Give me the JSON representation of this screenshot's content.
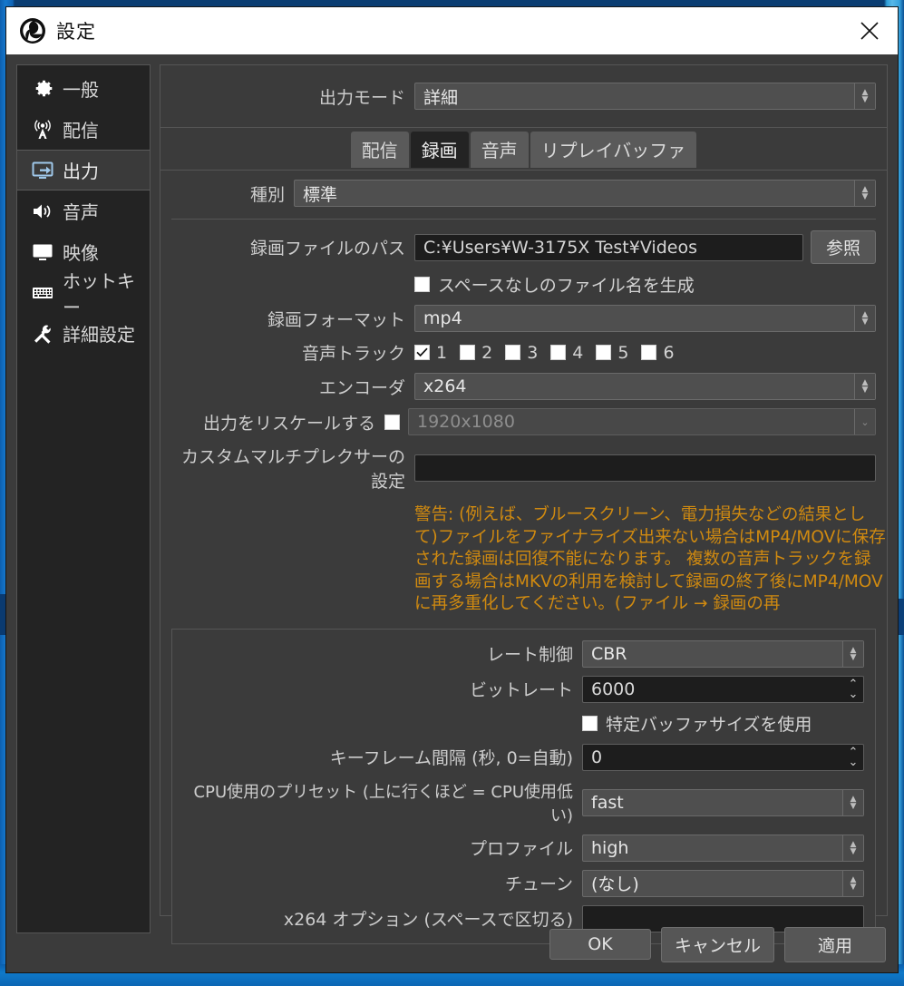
{
  "window": {
    "title": "設定",
    "logo_icon": "obs-logo-icon",
    "close_icon": "close-icon"
  },
  "sidebar": {
    "items": [
      {
        "label": "一般",
        "icon": "gear-icon",
        "active": false
      },
      {
        "label": "配信",
        "icon": "broadcast-icon",
        "active": false
      },
      {
        "label": "出力",
        "icon": "output-monitor-icon",
        "active": true
      },
      {
        "label": "音声",
        "icon": "speaker-icon",
        "active": false
      },
      {
        "label": "映像",
        "icon": "monitor-icon",
        "active": false
      },
      {
        "label": "ホットキー",
        "icon": "keyboard-icon",
        "active": false
      },
      {
        "label": "詳細設定",
        "icon": "tools-icon",
        "active": false
      }
    ]
  },
  "output_mode": {
    "label": "出力モード",
    "value": "詳細"
  },
  "tabs": [
    {
      "label": "配信",
      "active": false
    },
    {
      "label": "録画",
      "active": true
    },
    {
      "label": "音声",
      "active": false
    },
    {
      "label": "リプレイバッファ",
      "active": false
    }
  ],
  "recording": {
    "type_label": "種別",
    "type_value": "標準",
    "path_label": "録画ファイルのパス",
    "path_value": "C:¥Users¥W-3175X Test¥Videos",
    "browse_button": "参照",
    "nospace_checkbox_label": "スペースなしのファイル名を生成",
    "nospace_checked": false,
    "format_label": "録画フォーマット",
    "format_value": "mp4",
    "tracks_label": "音声トラック",
    "tracks": [
      {
        "num": "1",
        "checked": true
      },
      {
        "num": "2",
        "checked": false
      },
      {
        "num": "3",
        "checked": false
      },
      {
        "num": "4",
        "checked": false
      },
      {
        "num": "5",
        "checked": false
      },
      {
        "num": "6",
        "checked": false
      }
    ],
    "encoder_label": "エンコーダ",
    "encoder_value": "x264",
    "rescale_label": "出力をリスケールする",
    "rescale_checked": false,
    "rescale_value": "1920x1080",
    "muxer_label": "カスタムマルチプレクサーの設定",
    "muxer_value": "",
    "warning": "警告: (例えば、ブルースクリーン、電力損失などの結果として)ファイルをファイナライズ出来ない場合はMP4/MOVに保存された録画は回復不能になります。 複数の音声トラックを録画する場合はMKVの利用を検討して録画の終了後にMP4/MOVに再多重化してください。(ファイル → 録画の再"
  },
  "encoder_settings": {
    "rate_control_label": "レート制御",
    "rate_control_value": "CBR",
    "bitrate_label": "ビットレート",
    "bitrate_value": "6000",
    "buffer_checkbox_label": "特定バッファサイズを使用",
    "buffer_checked": false,
    "keyframe_label": "キーフレーム間隔 (秒, 0=自動)",
    "keyframe_value": "0",
    "cpu_preset_label": "CPU使用のプリセット (上に行くほど = CPU使用低い)",
    "cpu_preset_value": "fast",
    "profile_label": "プロファイル",
    "profile_value": "high",
    "tune_label": "チューン",
    "tune_value": "(なし)",
    "x264_options_label": "x264 オプション (スペースで区切る)",
    "x264_options_value": ""
  },
  "footer": {
    "ok": "OK",
    "cancel": "キャンセル",
    "apply": "適用"
  },
  "colors": {
    "warning": "#d08a10",
    "window_bg": "#3b3b3b",
    "sidebar_bg": "#232323",
    "desktop": "#0a3d72"
  }
}
